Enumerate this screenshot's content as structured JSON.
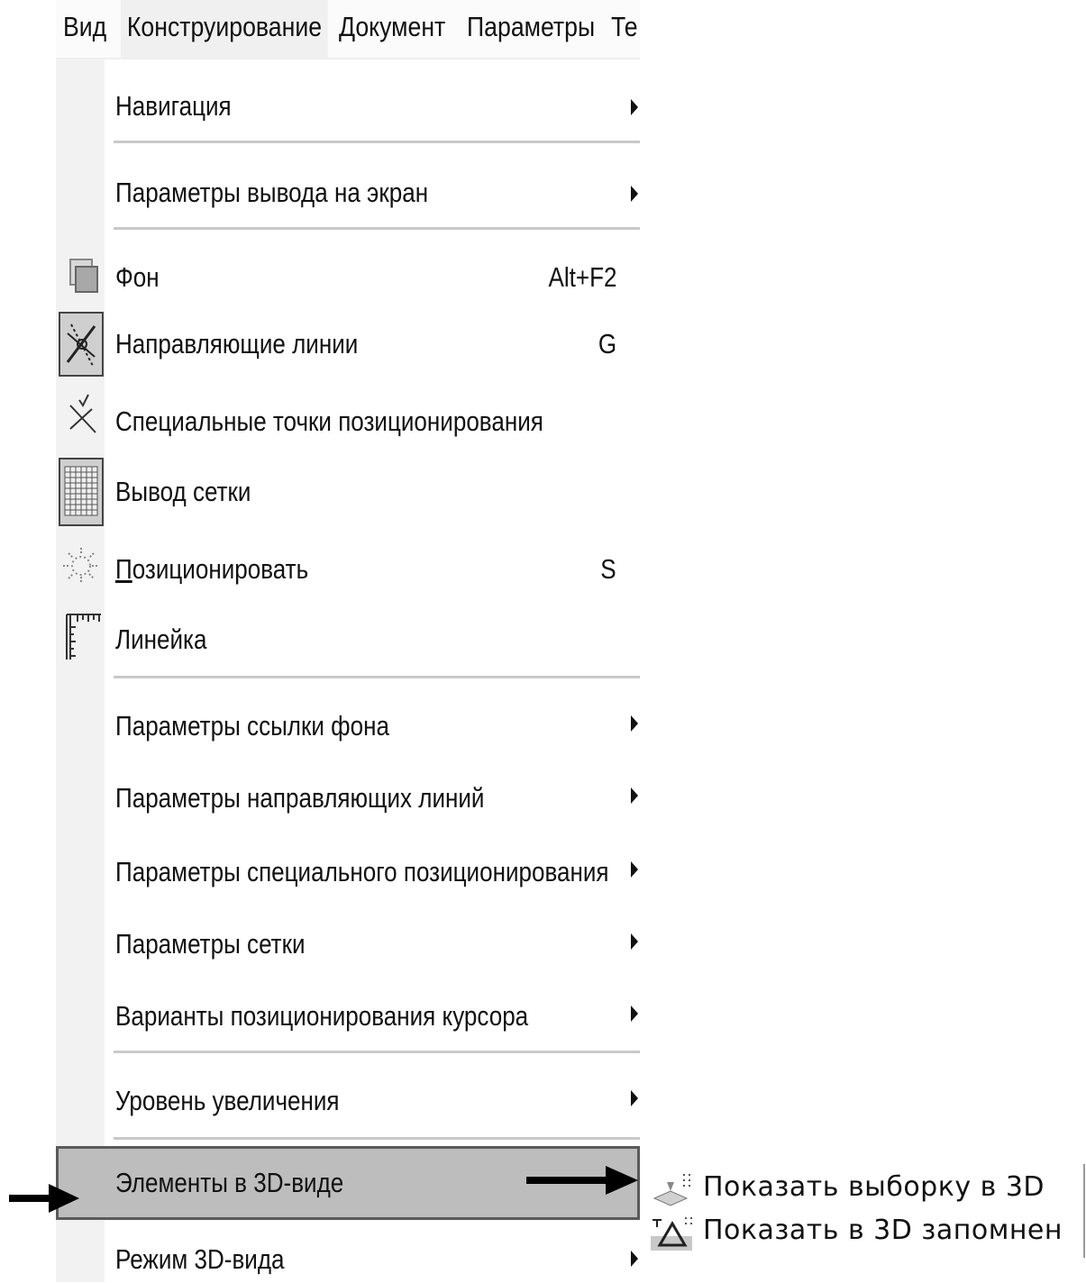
{
  "menubar": {
    "items": [
      {
        "label": "Вид"
      },
      {
        "label": "Конструирование"
      },
      {
        "label": "Документ"
      },
      {
        "label": "Параметры"
      },
      {
        "label": "Те"
      }
    ]
  },
  "menu": {
    "items": [
      {
        "label": "Навигация",
        "submenu": true
      },
      {
        "label": "Параметры вывода на экран",
        "submenu": true
      },
      {
        "label": "Фон",
        "shortcut": "Alt+F2",
        "icon": "background-icon"
      },
      {
        "label": "Направляющие линии",
        "shortcut": "G",
        "icon": "guide-lines-icon",
        "checked": true
      },
      {
        "label": "Специальные точки позиционирования",
        "icon": "snap-points-icon"
      },
      {
        "label": "Вывод сетки",
        "icon": "grid-icon",
        "checked": true
      },
      {
        "label_first": "П",
        "label_rest": "озиционировать",
        "shortcut": "S",
        "icon": "snap-icon"
      },
      {
        "label": "Линейка",
        "icon": "ruler-icon"
      },
      {
        "label": "Параметры ссылки фона",
        "submenu": true
      },
      {
        "label": "Параметры направляющих линий",
        "submenu": true
      },
      {
        "label": "Параметры специального позиционирования",
        "submenu": true
      },
      {
        "label": "Параметры сетки",
        "submenu": true
      },
      {
        "label": "Варианты позиционирования курсора",
        "submenu": true
      },
      {
        "label": "Уровень увеличения",
        "submenu": true
      },
      {
        "label": "Элементы в 3D-виде",
        "submenu": true,
        "highlighted": true
      },
      {
        "label": "Режим 3D-вида",
        "submenu": true
      }
    ]
  },
  "submenu": {
    "items": [
      {
        "label": "Показать выборку в 3D",
        "icon": "show-selection-3d-icon"
      },
      {
        "label": "Показать в 3D запомнен",
        "icon": "show-saved-3d-icon"
      }
    ]
  },
  "colors": {
    "highlight": "#bdbdbd",
    "highlight_border": "#5a5a5a",
    "gutter": "#f2f2f2",
    "separator": "#c9c9c9"
  }
}
